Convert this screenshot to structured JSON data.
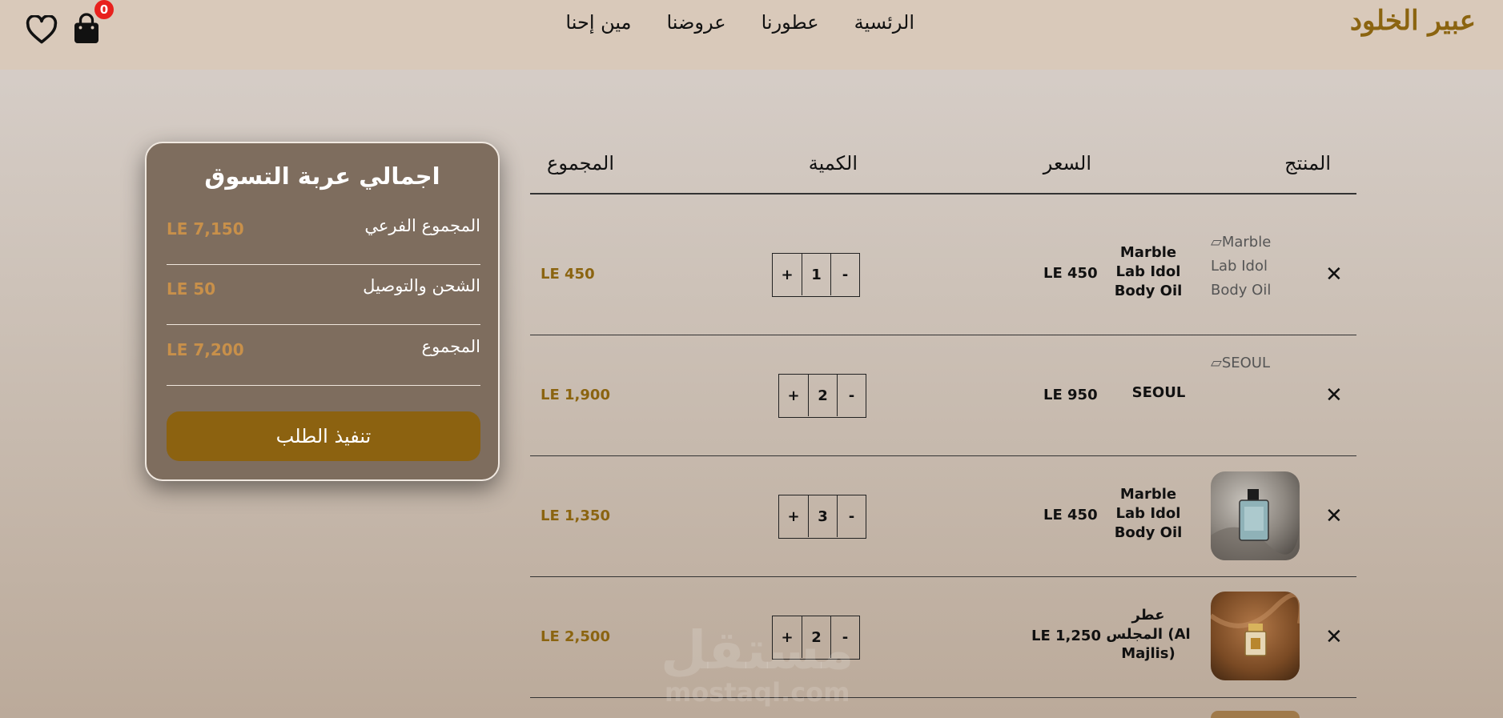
{
  "header": {
    "brand": "عبير الخلود",
    "nav": [
      "الرئسية",
      "عطورنا",
      "عروضنا",
      "مين إحنا"
    ],
    "cart_count": "0",
    "icons": [
      "heart-icon",
      "shopping-bag-icon"
    ]
  },
  "table": {
    "headers": {
      "product": "المنتج",
      "price": "السعر",
      "quantity": "الكمية",
      "total": "المجموع"
    },
    "remove_symbol": "✕",
    "rows": [
      {
        "image_alt": "Marble Lab Idol Body Oil",
        "name": "Marble Lab Idol Body Oil",
        "price": "LE 450",
        "minus": "-",
        "qty": "1",
        "plus": "+",
        "total": "LE 450"
      },
      {
        "image_alt": "SEOUL",
        "name": "SEOUL",
        "price": "LE 950",
        "minus": "-",
        "qty": "2",
        "plus": "+",
        "total": "LE 1,900"
      },
      {
        "image_alt": "",
        "name": "Marble Lab Idol Body Oil",
        "price": "LE 450",
        "minus": "-",
        "qty": "3",
        "plus": "+",
        "total": "LE 1,350"
      },
      {
        "image_alt": "",
        "name": "عطر المجلس (Al Majlis)",
        "price": "LE 1,250",
        "minus": "-",
        "qty": "2",
        "plus": "+",
        "total": "LE 2,500"
      }
    ]
  },
  "summary": {
    "title": "اجمالي عربة التسوق",
    "subtotal_label": "المجموع الفرعي",
    "subtotal_value": "LE 7,150",
    "shipping_label": "الشحن والتوصيل",
    "shipping_value": "LE 50",
    "total_label": "المجموع",
    "total_value": "LE 7,200",
    "checkout_label": "تنفيذ الطلب"
  },
  "watermark": {
    "line1": "مستقل",
    "line2": "mostaql.com"
  },
  "colors": {
    "accent": "#8b6410",
    "card": "#7e6d5e",
    "badge": "#e8211d"
  }
}
